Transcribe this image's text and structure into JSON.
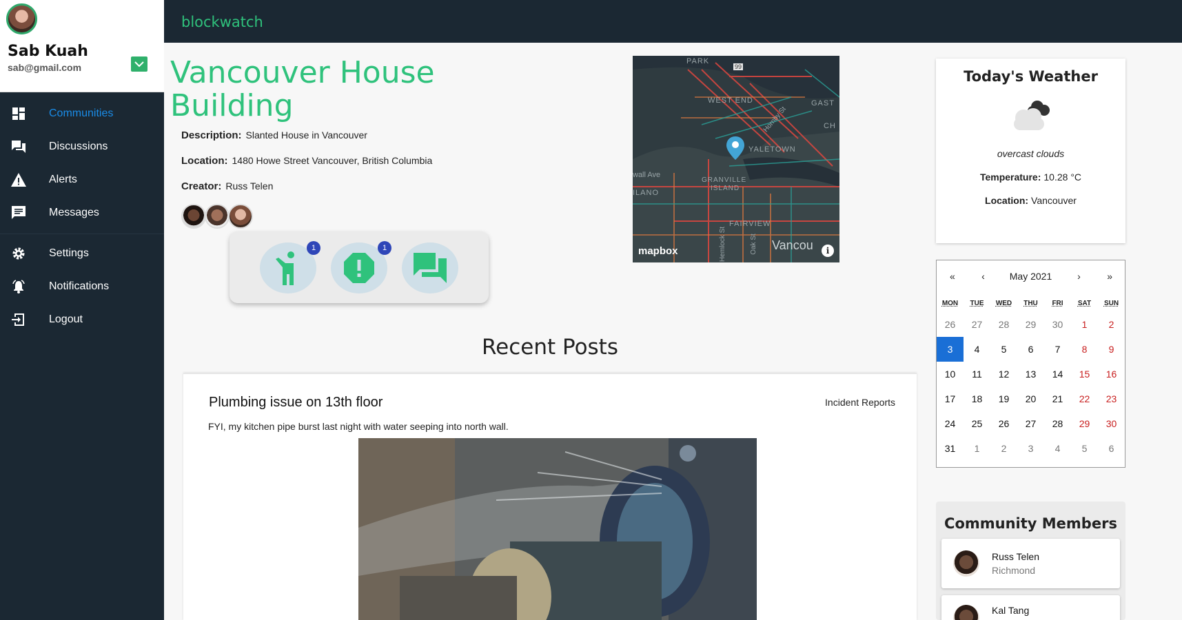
{
  "app": {
    "brand": "blockwatch"
  },
  "user": {
    "name": "Sab Kuah",
    "email": "sab@gmail.com"
  },
  "nav": {
    "items": [
      {
        "label": "Communities",
        "icon": "dashboard-icon",
        "active": true
      },
      {
        "label": "Discussions",
        "icon": "forum-icon"
      },
      {
        "label": "Alerts",
        "icon": "warning-icon"
      },
      {
        "label": "Messages",
        "icon": "message-icon"
      }
    ],
    "secondary": [
      {
        "label": "Settings",
        "icon": "gear-icon"
      },
      {
        "label": "Notifications",
        "icon": "bell-icon"
      },
      {
        "label": "Logout",
        "icon": "logout-icon"
      }
    ]
  },
  "community": {
    "title": "Vancouver House Building",
    "description_label": "Description:",
    "description": "Slanted House in Vancouver",
    "location_label": "Location:",
    "location": "1480 Howe Street Vancouver, British Columbia",
    "creator_label": "Creator:",
    "creator": "Russ Telen"
  },
  "actions": {
    "incident_badge": "1",
    "alert_badge": "1"
  },
  "map": {
    "labels": {
      "park": "PARK",
      "west_end": "WEST END",
      "yaletown": "YALETOWN",
      "granville": "GRANVILLE",
      "island": "ISLAND",
      "fairview": "FAIRVIEW",
      "ilano": "ILANO",
      "wall_ave": "wall Ave",
      "gast": "GAST",
      "ch": "CH",
      "vancouver": "Vancou",
      "hornby": "Hornby St",
      "hemlock": "Hemlock St",
      "oak": "Oak St",
      "highway": "99"
    },
    "logo": "mapbox"
  },
  "posts": {
    "heading": "Recent Posts",
    "items": [
      {
        "title": "Plumbing issue on 13th floor",
        "category": "Incident Reports",
        "body": "FYI, my kitchen pipe burst last night with water seeping into north wall."
      }
    ]
  },
  "weather": {
    "title": "Today's Weather",
    "description": "overcast clouds",
    "temperature_label": "Temperature:",
    "temperature": "10.28 °C",
    "location_label": "Location:",
    "location": "Vancouver"
  },
  "calendar": {
    "month": "May 2021",
    "nav": {
      "prev_year": "«",
      "prev": "‹",
      "next": "›",
      "next_year": "»"
    },
    "weekdays": [
      "MON",
      "TUE",
      "WED",
      "THU",
      "FRI",
      "SAT",
      "SUN"
    ],
    "weeks": [
      [
        "26",
        "27",
        "28",
        "29",
        "30",
        "1",
        "2"
      ],
      [
        "3",
        "4",
        "5",
        "6",
        "7",
        "8",
        "9"
      ],
      [
        "10",
        "11",
        "12",
        "13",
        "14",
        "15",
        "16"
      ],
      [
        "17",
        "18",
        "19",
        "20",
        "21",
        "22",
        "23"
      ],
      [
        "24",
        "25",
        "26",
        "27",
        "28",
        "29",
        "30"
      ],
      [
        "31",
        "1",
        "2",
        "3",
        "4",
        "5",
        "6"
      ]
    ],
    "selected": "3"
  },
  "members": {
    "title": "Community Members",
    "items": [
      {
        "name": "Russ Telen",
        "city": "Richmond"
      },
      {
        "name": "Kal Tang",
        "city": ""
      }
    ]
  },
  "colors": {
    "accent": "#2fc27c",
    "sidebar": "#1b2833",
    "active_nav": "#1a8ce8",
    "badge": "#2f46b8",
    "weekend": "#c81d1d",
    "selected_day": "#1a6fd6"
  }
}
